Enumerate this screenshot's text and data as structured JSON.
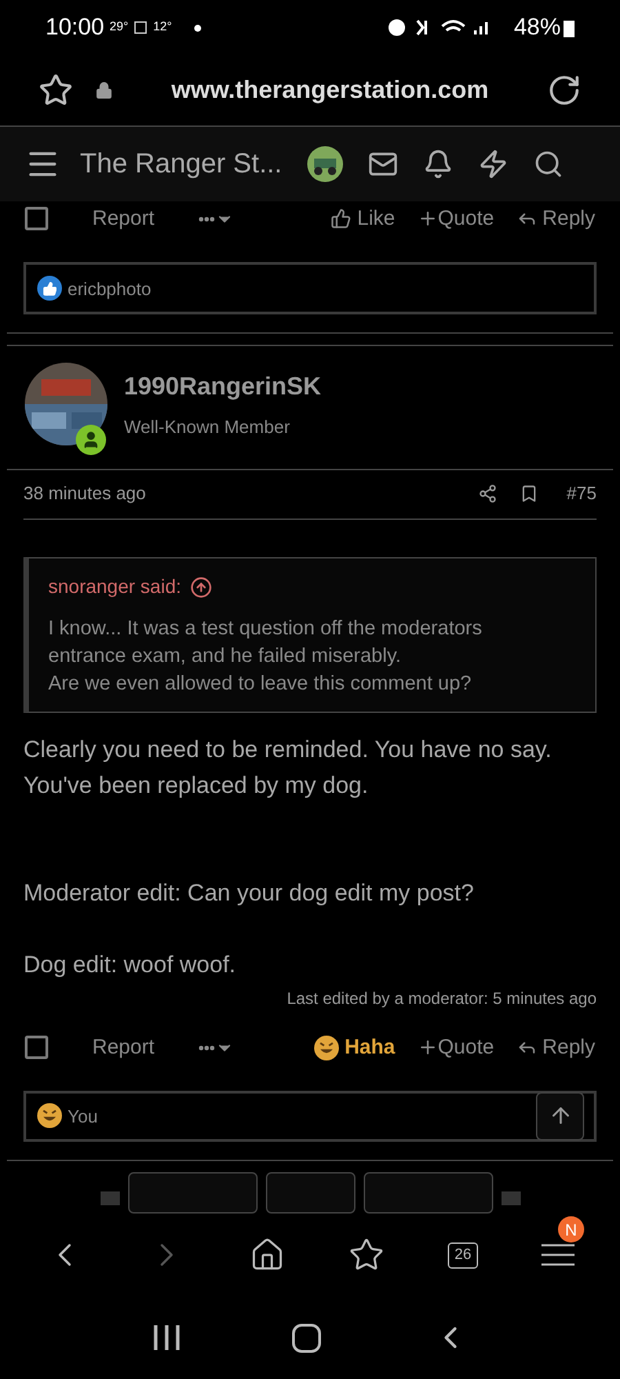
{
  "status_bar": {
    "time": "10:00",
    "temp_1": "29°",
    "temp_2": "12°",
    "battery": "48%"
  },
  "browser": {
    "url": "www.therangerstation.com"
  },
  "site_header": {
    "title": "The Ranger St..."
  },
  "posts": [
    {
      "actions": {
        "checked": false,
        "report": "Report",
        "reaction": {
          "kind": "like",
          "label": "Like",
          "selected": false
        },
        "quote": "Quote",
        "reply": "Reply"
      },
      "reactions": {
        "kind": "like",
        "text": "ericbphoto"
      }
    },
    {
      "author": "1990RangerinSK",
      "role": "Well-Known Member",
      "time": "38 minutes ago",
      "number": "#75",
      "quote": {
        "author": "snoranger said:",
        "lines": [
          "I know... It was a test question off the moderators entrance exam, and he failed miserably.",
          "Are we even allowed to leave this comment up?"
        ]
      },
      "body": [
        "Clearly you need to be reminded. You have no say. You've been replaced by my dog.",
        "Moderator edit: Can your dog edit my post?",
        "Dog edit: woof woof."
      ],
      "edited": "Last edited by a moderator: 5 minutes ago",
      "actions": {
        "checked": false,
        "report": "Report",
        "reaction": {
          "kind": "haha",
          "label": "Haha",
          "selected": true
        },
        "quote": "Quote",
        "reply": "Reply"
      },
      "reactions": {
        "kind": "haha",
        "text": "You"
      }
    }
  ],
  "bottom_bar": {
    "back_disabled": false,
    "forward_disabled": true,
    "tabs_count": "26",
    "menu_badge": "N"
  }
}
